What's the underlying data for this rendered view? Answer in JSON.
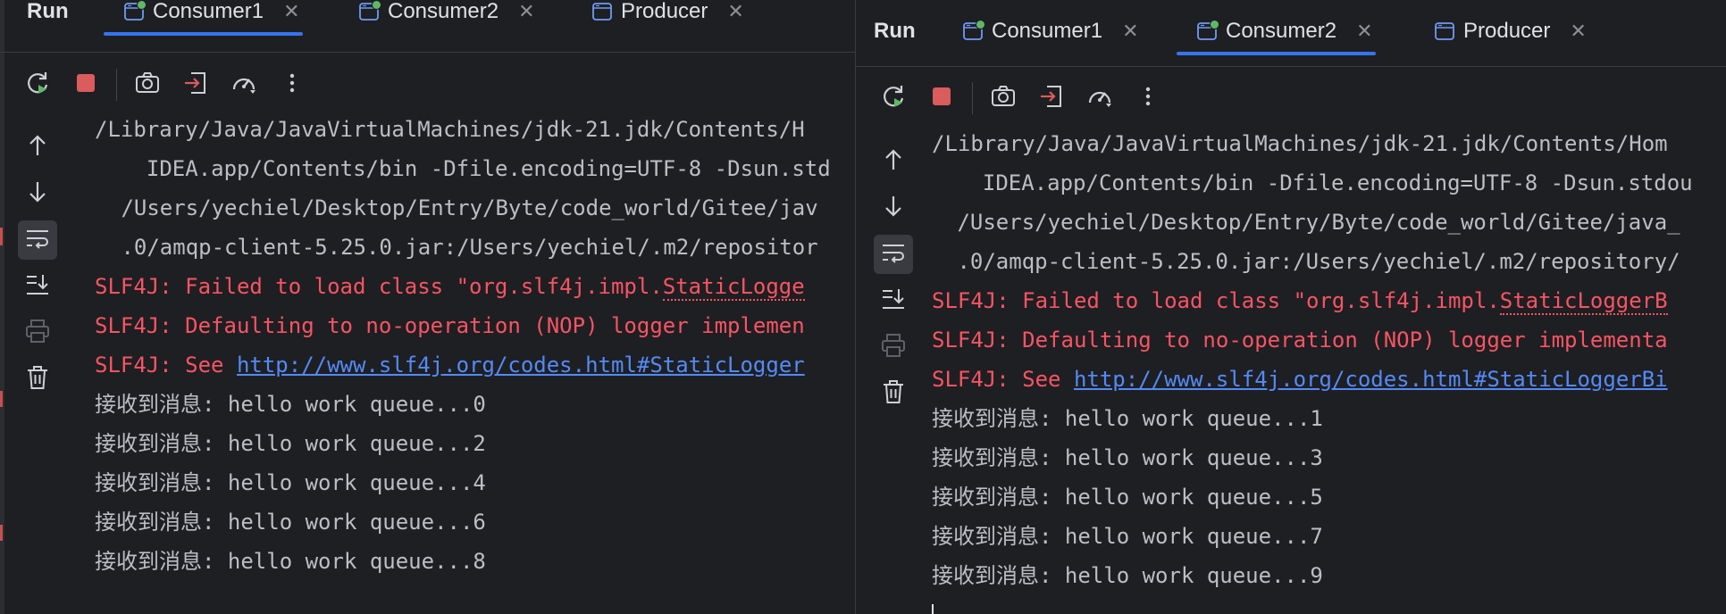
{
  "panels": [
    {
      "id": "left",
      "run_title": "Run",
      "tabs": [
        {
          "label": "Consumer1",
          "active": true,
          "running": true
        },
        {
          "label": "Consumer2",
          "active": false,
          "running": true
        },
        {
          "label": "Producer",
          "active": false,
          "running": false
        }
      ],
      "console": {
        "lines": [
          {
            "text": "/Library/Java/JavaVirtualMachines/jdk-21.jdk/Contents/H",
            "style": "normal"
          },
          {
            "text": "  IDEA.app/Contents/bin -Dfile.encoding=UTF-8 -Dsun.std",
            "style": "normal"
          },
          {
            "text": " /Users/yechiel/Desktop/Entry/Byte/code_world/Gitee/jav",
            "style": "normal"
          },
          {
            "text": " .0/amqp-client-5.25.0.jar:/Users/yechiel/.m2/repositor",
            "style": "normal"
          },
          {
            "text": "SLF4J: Failed to load class \"org.slf4j.impl.StaticLogge",
            "style": "error"
          },
          {
            "text": "SLF4J: Defaulting to no-operation (NOP) logger implemen",
            "style": "error"
          },
          {
            "prefix": "SLF4J: See ",
            "link": "http://www.slf4j.org/codes.html#StaticLogger",
            "style": "link"
          },
          {
            "text": "接收到消息: hello work queue...0",
            "style": "normal"
          },
          {
            "text": "接收到消息: hello work queue...2",
            "style": "normal"
          },
          {
            "text": "接收到消息: hello work queue...4",
            "style": "normal"
          },
          {
            "text": "接收到消息: hello work queue...6",
            "style": "normal"
          },
          {
            "text": "接收到消息: hello work queue...8",
            "style": "normal"
          }
        ]
      }
    },
    {
      "id": "right",
      "run_title": "Run",
      "tabs": [
        {
          "label": "Consumer1",
          "active": false,
          "running": true
        },
        {
          "label": "Consumer2",
          "active": true,
          "running": true
        },
        {
          "label": "Producer",
          "active": false,
          "running": false
        }
      ],
      "console": {
        "lines": [
          {
            "text": "/Library/Java/JavaVirtualMachines/jdk-21.jdk/Contents/Hom",
            "style": "normal"
          },
          {
            "text": "  IDEA.app/Contents/bin -Dfile.encoding=UTF-8 -Dsun.stdou",
            "style": "normal"
          },
          {
            "text": " /Users/yechiel/Desktop/Entry/Byte/code_world/Gitee/java_",
            "style": "normal"
          },
          {
            "text": " .0/amqp-client-5.25.0.jar:/Users/yechiel/.m2/repository/",
            "style": "normal"
          },
          {
            "text": "SLF4J: Failed to load class \"org.slf4j.impl.StaticLoggerB",
            "style": "error"
          },
          {
            "text": "SLF4J: Defaulting to no-operation (NOP) logger implementa",
            "style": "error"
          },
          {
            "prefix": "SLF4J: See ",
            "link": "http://www.slf4j.org/codes.html#StaticLoggerBi",
            "style": "link"
          },
          {
            "text": "接收到消息: hello work queue...1",
            "style": "normal"
          },
          {
            "text": "接收到消息: hello work queue...3",
            "style": "normal"
          },
          {
            "text": "接收到消息: hello work queue...5",
            "style": "normal"
          },
          {
            "text": "接收到消息: hello work queue...7",
            "style": "normal"
          },
          {
            "text": "接收到消息: hello work queue...9",
            "style": "normal"
          }
        ]
      }
    }
  ],
  "toolbar_icons": [
    "rerun-icon",
    "stop-icon",
    "screenshot-icon",
    "exit-icon",
    "profiler-icon",
    "more-options-icon"
  ],
  "rail_icons": [
    "scroll-up-icon",
    "scroll-down-icon",
    "soft-wrap-icon",
    "scroll-to-end-icon",
    "print-icon",
    "clear-all-icon"
  ],
  "colors": {
    "background": "#1e1f22",
    "text": "#bcbec4",
    "error": "#f75464",
    "link": "#548af7",
    "accent": "#3574f0",
    "running": "#5fb865",
    "stop": "#db5c5c"
  }
}
